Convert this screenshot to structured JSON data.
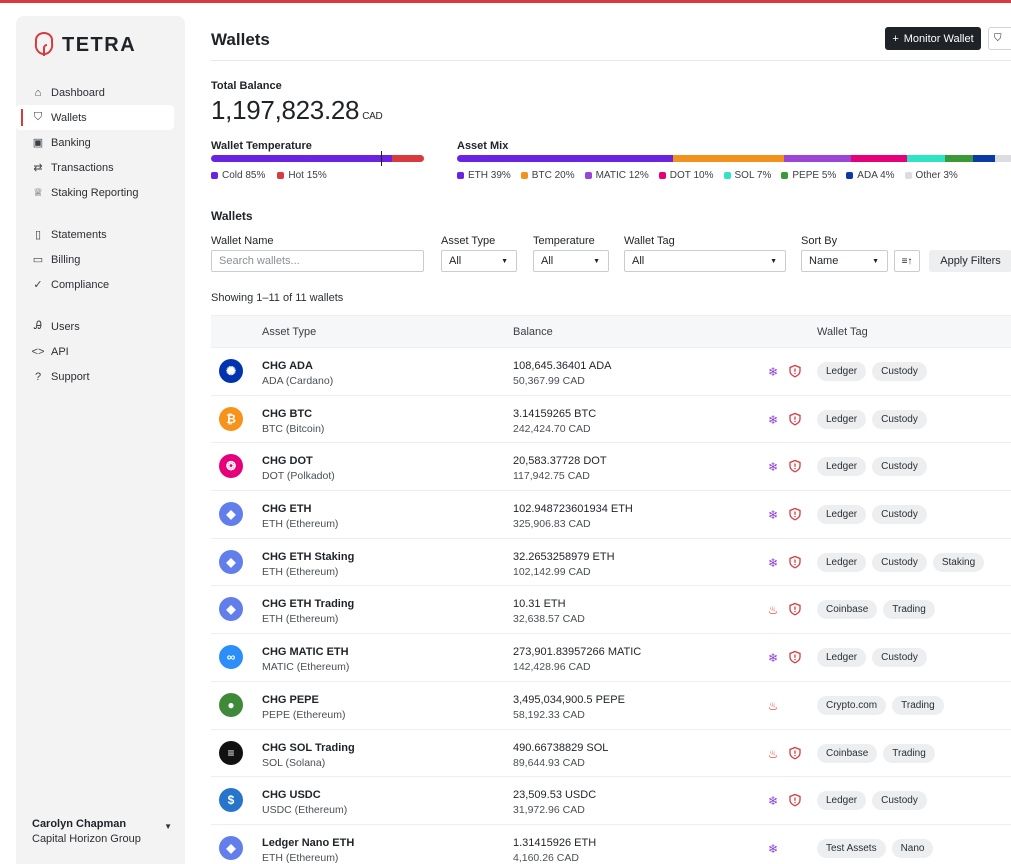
{
  "brand": {
    "name": "TETRA"
  },
  "sidebar": {
    "groups": [
      [
        {
          "label": "Dashboard",
          "icon": "home-icon",
          "glyph": "⌂"
        },
        {
          "label": "Wallets",
          "icon": "shield-icon",
          "glyph": "⛉",
          "active": true
        },
        {
          "label": "Banking",
          "icon": "bank-icon",
          "glyph": "▣"
        },
        {
          "label": "Transactions",
          "icon": "transfer-icon",
          "glyph": "⇄"
        },
        {
          "label": "Staking Reporting",
          "icon": "trophy-icon",
          "glyph": "♕"
        }
      ],
      [
        {
          "label": "Statements",
          "icon": "document-icon",
          "glyph": "▯"
        },
        {
          "label": "Billing",
          "icon": "receipt-icon",
          "glyph": "▭"
        },
        {
          "label": "Compliance",
          "icon": "check-circle-icon",
          "glyph": "✓"
        }
      ],
      [
        {
          "label": "Users",
          "icon": "users-icon",
          "glyph": "Ꭿ"
        },
        {
          "label": "API",
          "icon": "code-icon",
          "glyph": "<>"
        },
        {
          "label": "Support",
          "icon": "help-icon",
          "glyph": "?"
        }
      ]
    ],
    "user": {
      "name": "Carolyn Chapman",
      "org": "Capital Horizon Group"
    }
  },
  "header": {
    "title": "Wallets",
    "monitor_button": "Monitor Wallet"
  },
  "total_balance": {
    "label": "Total Balance",
    "value": "1,197,823.28",
    "currency": "CAD"
  },
  "wallet_temperature": {
    "label": "Wallet Temperature",
    "segments": [
      {
        "label": "Cold 85%",
        "percent": 85,
        "color": "#6a23e0"
      },
      {
        "label": "Hot 15%",
        "percent": 15,
        "color": "#d93a3f"
      }
    ]
  },
  "asset_mix": {
    "label": "Asset Mix",
    "segments": [
      {
        "label": "ETH 39%",
        "percent": 39,
        "color": "#6a23e0"
      },
      {
        "label": "BTC 20%",
        "percent": 20,
        "color": "#f2921d"
      },
      {
        "label": "MATIC 12%",
        "percent": 12,
        "color": "#9b45d6"
      },
      {
        "label": "DOT 10%",
        "percent": 10,
        "color": "#e6007a"
      },
      {
        "label": "SOL 7%",
        "percent": 7,
        "color": "#2fe3c5"
      },
      {
        "label": "PEPE 5%",
        "percent": 5,
        "color": "#3a9a3a"
      },
      {
        "label": "ADA 4%",
        "percent": 4,
        "color": "#0b3aa6"
      },
      {
        "label": "Other 3%",
        "percent": 3,
        "color": "#dcdde0"
      }
    ]
  },
  "filters": {
    "heading": "Wallets",
    "wallet_name_label": "Wallet Name",
    "wallet_name_placeholder": "Search wallets...",
    "asset_type_label": "Asset Type",
    "asset_type_value": "All",
    "temperature_label": "Temperature",
    "temperature_value": "All",
    "wallet_tag_label": "Wallet Tag",
    "wallet_tag_value": "All",
    "sort_by_label": "Sort By",
    "sort_by_value": "Name",
    "apply_label": "Apply Filters"
  },
  "showing_text": "Showing 1–11 of 11 wallets",
  "table": {
    "columns": [
      "Asset Type",
      "Balance",
      "Wallet Tag"
    ],
    "rows": [
      {
        "name": "CHG ADA",
        "asset": "ADA (Cardano)",
        "balance": "108,645.36401 ADA",
        "fiat": "50,367.99 CAD",
        "temperature": "cold",
        "shield": true,
        "tags": [
          "Ledger",
          "Custody"
        ],
        "coin": "ADA",
        "coin_color": "#0033ad",
        "glyph": "✺"
      },
      {
        "name": "CHG BTC",
        "asset": "BTC (Bitcoin)",
        "balance": "3.14159265 BTC",
        "fiat": "242,424.70 CAD",
        "temperature": "cold",
        "shield": true,
        "tags": [
          "Ledger",
          "Custody"
        ],
        "coin": "BTC",
        "coin_color": "#f7931a",
        "glyph": "₿"
      },
      {
        "name": "CHG DOT",
        "asset": "DOT (Polkadot)",
        "balance": "20,583.37728 DOT",
        "fiat": "117,942.75 CAD",
        "temperature": "cold",
        "shield": true,
        "tags": [
          "Ledger",
          "Custody"
        ],
        "coin": "DOT",
        "coin_color": "#e6007a",
        "glyph": "❂"
      },
      {
        "name": "CHG ETH",
        "asset": "ETH (Ethereum)",
        "balance": "102.948723601934 ETH",
        "fiat": "325,906.83 CAD",
        "temperature": "cold",
        "shield": true,
        "tags": [
          "Ledger",
          "Custody"
        ],
        "coin": "ETH",
        "coin_color": "#627eea",
        "glyph": "◆"
      },
      {
        "name": "CHG ETH Staking",
        "asset": "ETH (Ethereum)",
        "balance": "32.2653258979 ETH",
        "fiat": "102,142.99 CAD",
        "temperature": "cold",
        "shield": true,
        "tags": [
          "Ledger",
          "Custody",
          "Staking"
        ],
        "coin": "ETH",
        "coin_color": "#627eea",
        "glyph": "◆"
      },
      {
        "name": "CHG ETH Trading",
        "asset": "ETH (Ethereum)",
        "balance": "10.31 ETH",
        "fiat": "32,638.57 CAD",
        "temperature": "hot",
        "shield": true,
        "tags": [
          "Coinbase",
          "Trading"
        ],
        "coin": "ETH",
        "coin_color": "#627eea",
        "glyph": "◆"
      },
      {
        "name": "CHG MATIC ETH",
        "asset": "MATIC (Ethereum)",
        "balance": "273,901.83957266 MATIC",
        "fiat": "142,428.96 CAD",
        "temperature": "cold",
        "shield": true,
        "tags": [
          "Ledger",
          "Custody"
        ],
        "coin": "MATIC",
        "coin_color": "#2c8ef8",
        "glyph": "∞"
      },
      {
        "name": "CHG PEPE",
        "asset": "PEPE (Ethereum)",
        "balance": "3,495,034,900.5 PEPE",
        "fiat": "58,192.33 CAD",
        "temperature": "hot",
        "shield": false,
        "tags": [
          "Crypto.com",
          "Trading"
        ],
        "coin": "PEPE",
        "coin_color": "#3f8a3a",
        "glyph": "●"
      },
      {
        "name": "CHG SOL Trading",
        "asset": "SOL (Solana)",
        "balance": "490.66738829 SOL",
        "fiat": "89,644.93 CAD",
        "temperature": "hot",
        "shield": true,
        "tags": [
          "Coinbase",
          "Trading"
        ],
        "coin": "SOL",
        "coin_color": "#111111",
        "glyph": "≡"
      },
      {
        "name": "CHG USDC",
        "asset": "USDC (Ethereum)",
        "balance": "23,509.53 USDC",
        "fiat": "31,972.96 CAD",
        "temperature": "cold",
        "shield": true,
        "tags": [
          "Ledger",
          "Custody"
        ],
        "coin": "USDC",
        "coin_color": "#2775ca",
        "glyph": "$"
      },
      {
        "name": "Ledger Nano ETH",
        "asset": "ETH (Ethereum)",
        "balance": "1.31415926 ETH",
        "fiat": "4,160.26 CAD",
        "temperature": "cold",
        "shield": false,
        "tags": [
          "Test Assets",
          "Nano"
        ],
        "coin": "ETH",
        "coin_color": "#627eea",
        "glyph": "◆"
      }
    ]
  },
  "colors": {
    "accent": "#d93a3f",
    "primary_dark": "#1f2328",
    "cold": "#8b3fd9",
    "hot": "#d93a3f"
  }
}
